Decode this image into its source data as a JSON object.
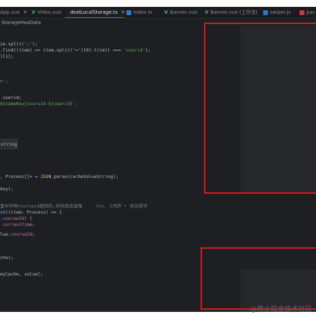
{
  "tabs": [
    {
      "label": "App.vue",
      "icon": "vue-icon"
    },
    {
      "label": "Video.vue",
      "icon": "vue-icon"
    },
    {
      "label": "dealLocalStorage.ts",
      "icon": "ts-icon",
      "active": true
    },
    {
      "label": "index.ts",
      "icon": "ts-icon"
    },
    {
      "label": "Banner.vue",
      "icon": "vue-icon"
    },
    {
      "label": "Banner.vue (工作流)",
      "icon": "vue-icon"
    },
    {
      "label": "swiper.js",
      "icon": "js-icon"
    },
    {
      "label": "pac",
      "icon": "npm-package-icon"
    }
  ],
  "breadcrumb": "StorageHasData",
  "code": {
    "l1": "ie.split(';');",
    "l2a": ".find((item) => item.split('=')[0].trim() === ",
    "l2b": "'userid'",
    "l2c": ");",
    "l3": ")[1];",
    "l4": "=';",
    "l5": " userid;",
    "l6a": "${sameKey}coursId-${userid}",
    "l6b": "`;",
    "tooltip": "string",
    "l7a": ", Process[]> = ",
    "l7b": "JSON",
    "l7c": ".parse(cacheValueString);",
    "l8": "key);",
    "l9_comment": "里中学种courseid相同的,并修改该值唯",
    "l9_hint": "You, 5两数 • 增加需求",
    "l10a": "nd",
    "l10b": "((item: Process) => {",
    "l11": ".courseId) {",
    "l12": " currentTime;",
    "l13a": "lue.",
    "l13b": "courseId",
    "l13c": ";",
    "l14": "che);",
    "l15": "eyCache, value];"
  },
  "watermark": "@稀土掘金技术社区"
}
